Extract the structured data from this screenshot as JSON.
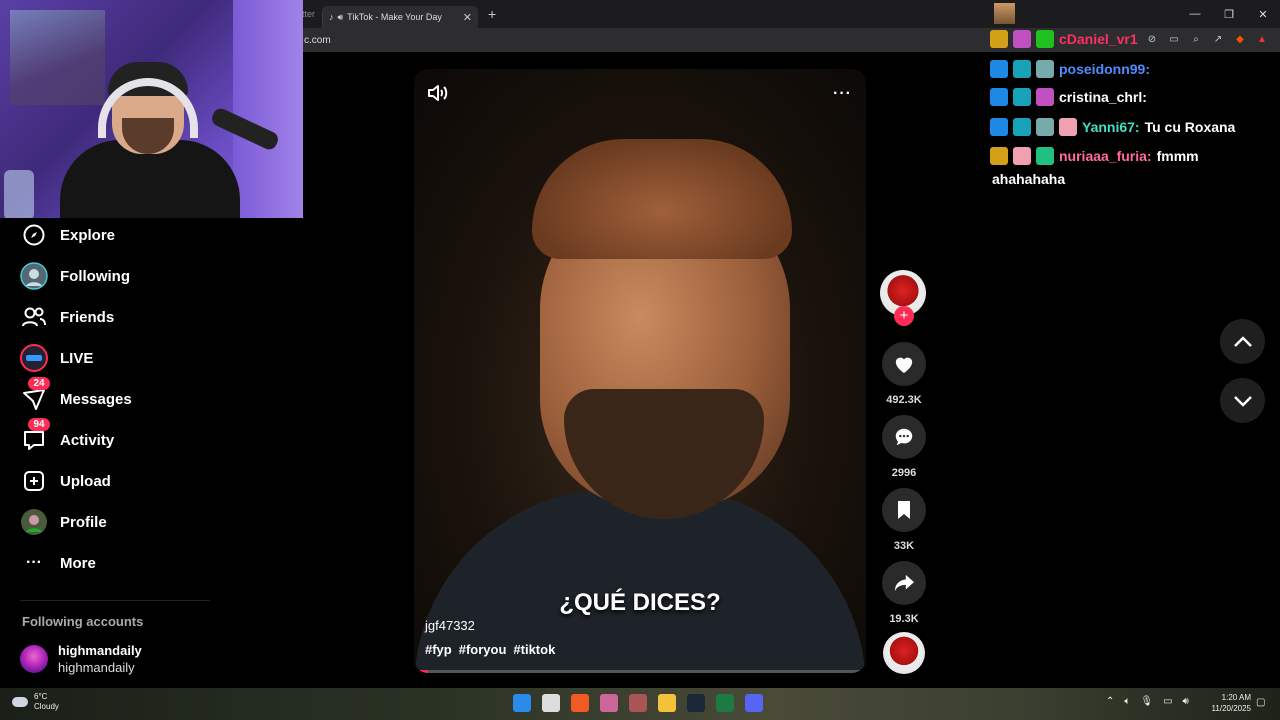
{
  "browser": {
    "partial_tab": "itter",
    "active_tab_title": "TikTok - Make Your Day",
    "url": "c.com"
  },
  "sidebar": {
    "items": [
      {
        "label": "Explore",
        "icon": "compass-icon"
      },
      {
        "label": "Following",
        "icon": "avatar-icon"
      },
      {
        "label": "Friends",
        "icon": "users-icon"
      },
      {
        "label": "LIVE",
        "icon": "live-icon"
      },
      {
        "label": "Messages",
        "icon": "paper-plane-icon",
        "badge": "24"
      },
      {
        "label": "Activity",
        "icon": "chat-bubble-icon",
        "badge": "94"
      },
      {
        "label": "Upload",
        "icon": "plus-square-icon"
      },
      {
        "label": "Profile",
        "icon": "avatar-icon"
      },
      {
        "label": "More",
        "icon": "ellipsis-icon"
      }
    ],
    "following_header": "Following accounts",
    "following_accounts": [
      {
        "username": "highmandaily",
        "name": "highmandaily"
      }
    ]
  },
  "video": {
    "caption": "¿QUÉ DICES?",
    "author": "jgf47332",
    "tags": [
      "#fyp",
      "#foryou",
      "#tiktok"
    ],
    "progress": 0.03
  },
  "actions": {
    "likes": "492.3K",
    "comments": "2996",
    "saves": "33K",
    "shares": "19.3K"
  },
  "chat": [
    {
      "user": "cDaniel_vr1",
      "message": "",
      "user_color": "#ff3060"
    },
    {
      "user": "poseidonn99:",
      "message": "",
      "user_color": "#4f8cff"
    },
    {
      "user": "cristina_chrl:",
      "message": "",
      "user_color": "#ffffff"
    },
    {
      "user": "Yanni67:",
      "message": "Tu cu Roxana",
      "user_color": "#40e0c0"
    },
    {
      "user": "nuriaaa_furia:",
      "message": "fmmm",
      "user_color": "#ff6aa0"
    },
    {
      "user": "",
      "message": "ahahahaha",
      "user_color": "#ffffff"
    }
  ],
  "taskbar": {
    "temperature": "6°C",
    "weather": "Cloudy",
    "time": "1:20 AM",
    "date": "11/20/2025"
  },
  "colors": {
    "accent": "#fe2c55",
    "background": "#000000"
  }
}
